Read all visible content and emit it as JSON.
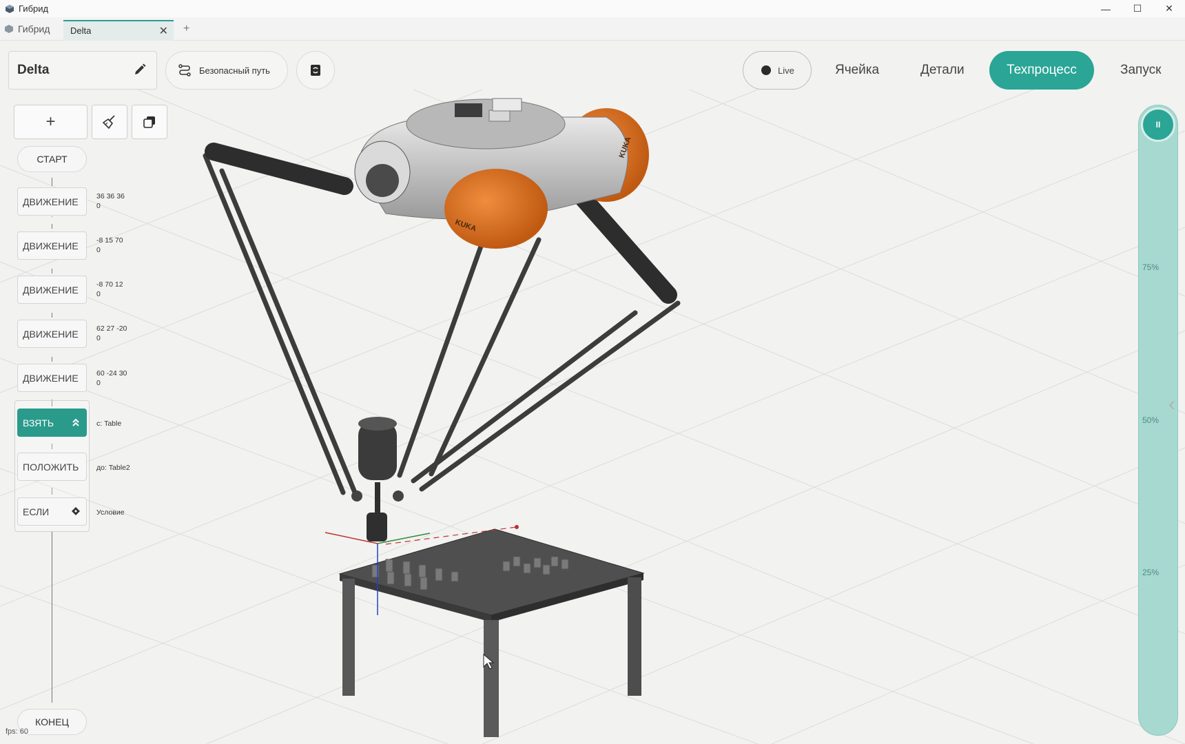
{
  "window": {
    "title": "Гибрид",
    "controls": {
      "minimize": "—",
      "maximize": "☐",
      "close": "✕"
    }
  },
  "tabs": {
    "home_label": "Гибрид",
    "active_tab": "Delta",
    "close_symbol": "✕",
    "add_symbol": "+"
  },
  "toolbar": {
    "project_name": "Delta",
    "safe_path_label": "Безопасный путь"
  },
  "nav": {
    "live_label": "Live",
    "items": [
      "Ячейка",
      "Детали",
      "Техпроцесс",
      "Запуск"
    ],
    "active": "Техпроцесс"
  },
  "program": {
    "add_symbol": "+",
    "start_label": "СТАРТ",
    "end_label": "КОНЕЦ",
    "steps": [
      {
        "label": "ДВИЖЕНИЕ",
        "params": [
          "36 36 36",
          "0"
        ]
      },
      {
        "label": "ДВИЖЕНИЕ",
        "params": [
          "-8 15 70",
          "0"
        ]
      },
      {
        "label": "ДВИЖЕНИЕ",
        "params": [
          "-8 70 12",
          "0"
        ]
      },
      {
        "label": "ДВИЖЕНИЕ",
        "params": [
          "62 27 -20",
          "0"
        ]
      },
      {
        "label": "ДВИЖЕНИЕ",
        "params": [
          "60 -24 30",
          "0"
        ]
      },
      {
        "label": "ВЗЯТЬ",
        "params": [
          "с: Table"
        ]
      },
      {
        "label": "ПОЛОЖИТЬ",
        "params": [
          "до: Table2"
        ]
      },
      {
        "label": "ЕСЛИ",
        "params": [
          "Условие"
        ]
      }
    ]
  },
  "speed": {
    "ticks": [
      "75%",
      "50%",
      "25%"
    ],
    "pause_symbol": "II"
  },
  "status": {
    "fps": "fps: 60"
  },
  "colors": {
    "accent": "#2aa596",
    "slider": "#a7d9d1",
    "robot_orange": "#e0782b"
  }
}
